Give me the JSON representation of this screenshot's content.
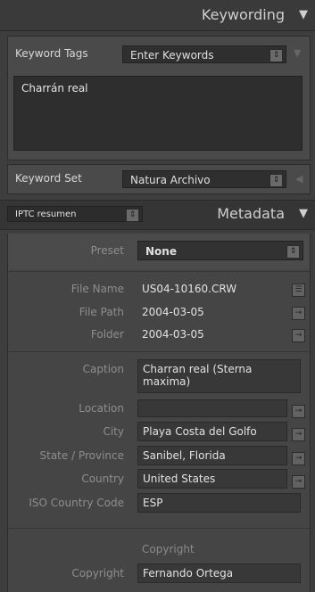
{
  "keywording": {
    "title": "Keywording"
  },
  "keyword_tags": {
    "label": "Keyword Tags",
    "mode": "Enter Keywords",
    "text": "Charrán real"
  },
  "keyword_set": {
    "label": "Keyword Set",
    "value": "Natura Archivo"
  },
  "metadata": {
    "view_select": "IPTC resumen",
    "title": "Metadata",
    "preset_label": "Preset",
    "preset_value": "None",
    "fields": {
      "file_name": {
        "label": "File Name",
        "value": "US04-10160.CRW"
      },
      "file_path": {
        "label": "File Path",
        "value": "2004-03-05"
      },
      "folder": {
        "label": "Folder",
        "value": "2004-03-05"
      },
      "caption": {
        "label": "Caption",
        "value": "Charran real (Sterna maxima)"
      },
      "location": {
        "label": "Location",
        "value": ""
      },
      "city": {
        "label": "City",
        "value": "Playa Costa del Golfo"
      },
      "state": {
        "label": "State / Province",
        "value": "Sanibel, Florida"
      },
      "country": {
        "label": "Country",
        "value": "United States"
      },
      "iso": {
        "label": "ISO Country Code",
        "value": "ESP"
      },
      "copyright_header": "Copyright",
      "copyright": {
        "label": "Copyright",
        "value": "Fernando Ortega"
      }
    }
  }
}
